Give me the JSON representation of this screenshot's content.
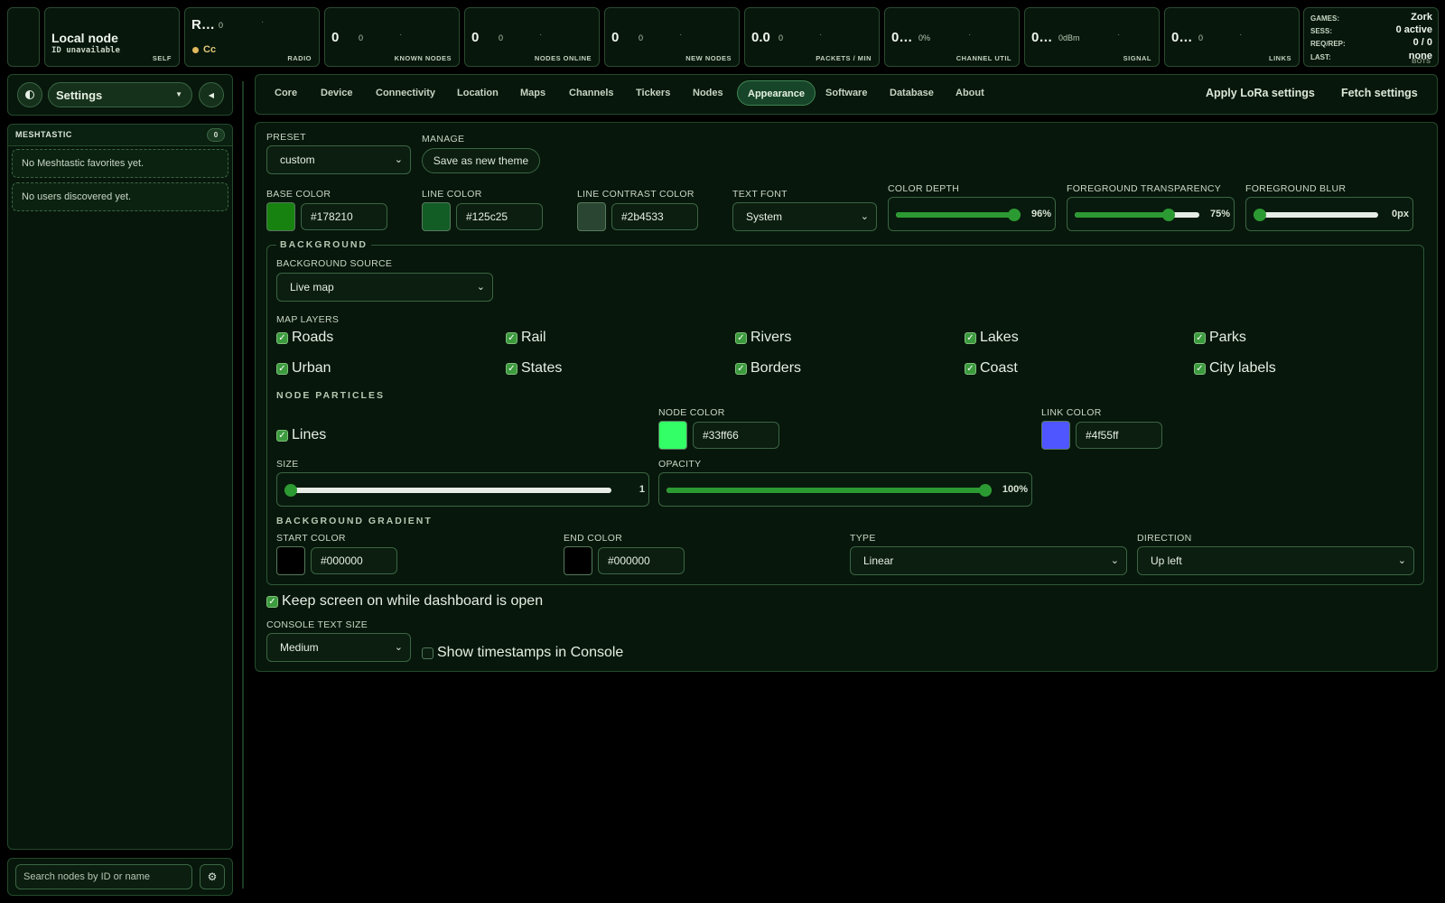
{
  "stats": {
    "self": {
      "title": "Local node",
      "subtitle": "ID unavailable",
      "label": "SELF"
    },
    "radio": {
      "value": "R…",
      "mini": "0",
      "status": "Cc",
      "label": "RADIO"
    },
    "known_nodes": {
      "value": "0",
      "mini": "0",
      "label": "KNOWN NODES"
    },
    "nodes_online": {
      "value": "0",
      "mini": "0",
      "label": "NODES ONLINE"
    },
    "new_nodes": {
      "value": "0",
      "mini": "0",
      "label": "NEW NODES"
    },
    "packets": {
      "value": "0.0",
      "mini": "0",
      "label": "PACKETS / MIN"
    },
    "channel_util": {
      "value": "0…",
      "mini": "0%",
      "label": "CHANNEL UTIL"
    },
    "signal": {
      "value": "0…",
      "mini": "0dBm",
      "label": "SIGNAL"
    },
    "links": {
      "value": "0…",
      "mini": "0",
      "label": "LINKS"
    },
    "games": {
      "games_label": "GAMES:",
      "games_value": "Zork",
      "sess_label": "SESS:",
      "sess_value": "0 active",
      "reqrep_label": "REQ/REP:",
      "reqrep_value": "0 / 0",
      "last_label": "LAST:",
      "last_value": "none",
      "overlap_label": "BOTS"
    }
  },
  "sidebar": {
    "view_select": "Settings",
    "section_title": "MESHTASTIC",
    "count": "0",
    "empty_favorites": "No Meshtastic favorites yet.",
    "empty_users": "No users discovered yet.",
    "search_placeholder": "Search nodes by ID or name"
  },
  "tabs": [
    "Core",
    "Device",
    "Connectivity",
    "Location",
    "Maps",
    "Channels",
    "Tickers",
    "Nodes",
    "Appearance",
    "Software",
    "Database",
    "About"
  ],
  "active_tab": "Appearance",
  "actions": {
    "apply": "Apply LoRa settings",
    "fetch": "Fetch settings"
  },
  "appearance": {
    "preset_label": "PRESET",
    "preset_value": "custom",
    "manage_label": "MANAGE",
    "save_theme": "Save as new theme",
    "base_color_label": "BASE COLOR",
    "base_color": "#178210",
    "line_color_label": "LINE COLOR",
    "line_color": "#125c25",
    "line_contrast_label": "LINE CONTRAST COLOR",
    "line_contrast_color": "#2b4533",
    "text_font_label": "TEXT FONT",
    "text_font": "System",
    "color_depth_label": "COLOR DEPTH",
    "color_depth": "96%",
    "color_depth_frac": 0.96,
    "fg_transparency_label": "FOREGROUND TRANSPARENCY",
    "fg_transparency": "75%",
    "fg_transparency_frac": 0.75,
    "fg_blur_label": "FOREGROUND BLUR",
    "fg_blur": "0px",
    "fg_blur_frac": 0.0
  },
  "background": {
    "title": "BACKGROUND",
    "source_label": "BACKGROUND SOURCE",
    "source_value": "Live map",
    "layers_label": "MAP LAYERS",
    "layers": [
      "Roads",
      "Rail",
      "Rivers",
      "Lakes",
      "Parks",
      "Urban",
      "States",
      "Borders",
      "Coast",
      "City labels"
    ],
    "particles_title": "NODE PARTICLES",
    "lines_label": "Lines",
    "node_color_label": "NODE COLOR",
    "node_color": "#33ff66",
    "link_color_label": "LINK COLOR",
    "link_color": "#4f55ff",
    "size_label": "SIZE",
    "size_value": "1",
    "size_frac": 0.0,
    "opacity_label": "OPACITY",
    "opacity_value": "100%",
    "opacity_frac": 1.0,
    "gradient_title": "BACKGROUND GRADIENT",
    "start_color_label": "START COLOR",
    "start_color": "#000000",
    "end_color_label": "END COLOR",
    "end_color": "#000000",
    "type_label": "TYPE",
    "type_value": "Linear",
    "direction_label": "DIRECTION",
    "direction_value": "Up left"
  },
  "misc": {
    "keep_screen": "Keep screen on while dashboard is open",
    "console_size_label": "CONSOLE TEXT SIZE",
    "console_size": "Medium",
    "show_timestamps": "Show timestamps in Console"
  },
  "colors": {
    "accent": "#2c9a32",
    "panel_bg": "#07170b",
    "border": "#244a2c"
  }
}
